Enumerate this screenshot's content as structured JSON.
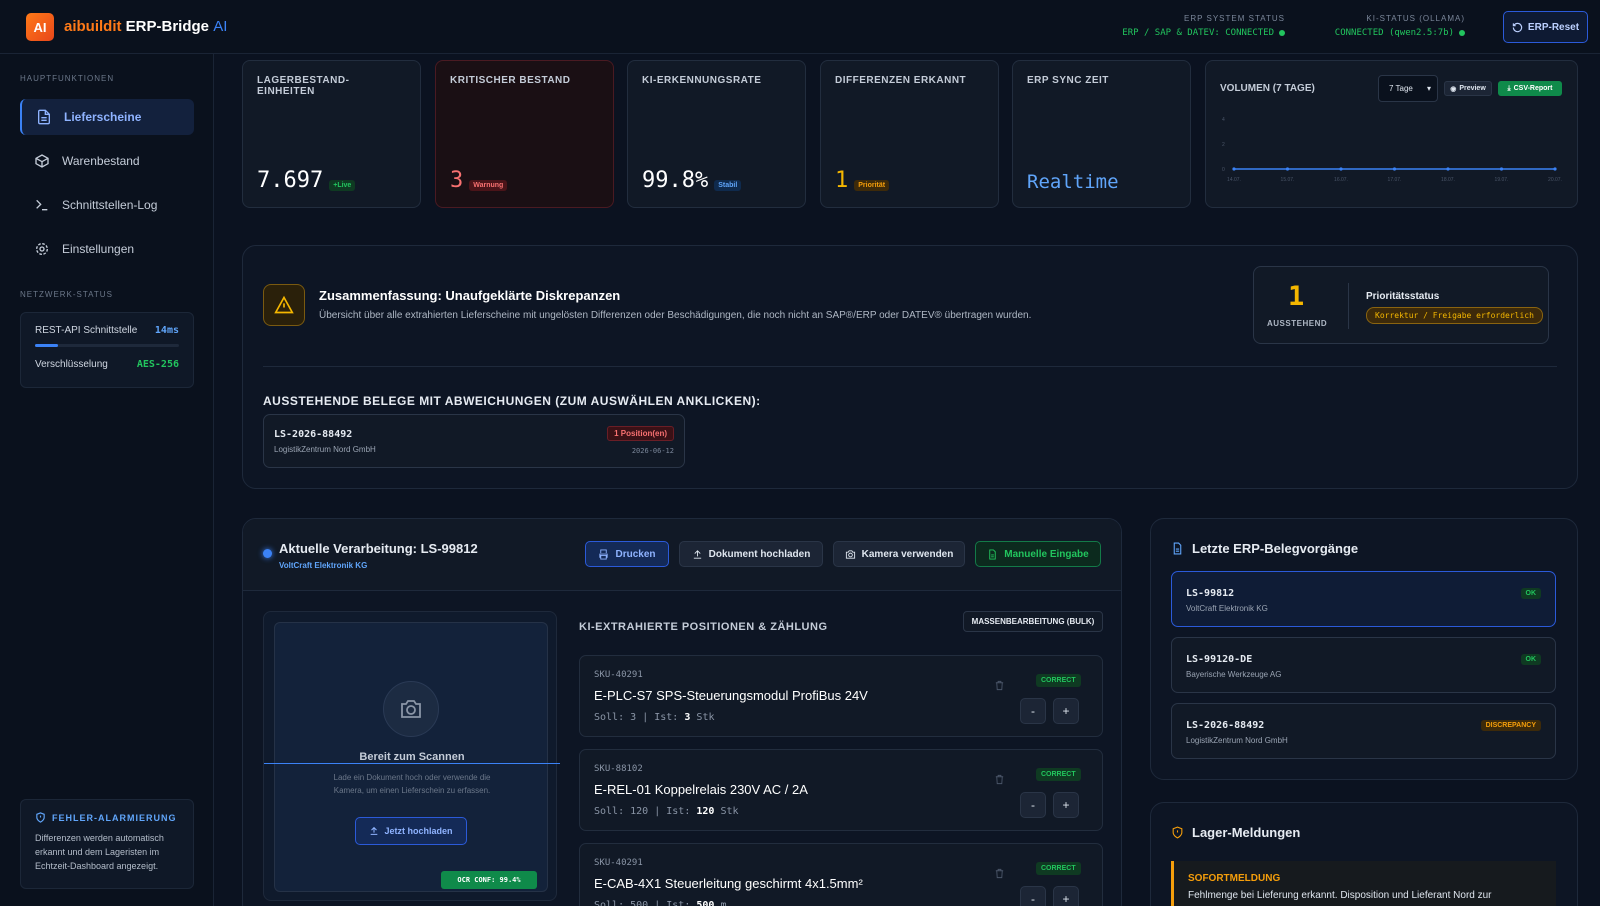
{
  "header": {
    "logo": "AI",
    "brand_1": "aibuildit",
    "brand_2": "ERP-Bridge",
    "brand_3": "AI",
    "erp_status_label": "ERP SYSTEM STATUS",
    "erp_status_value": "ERP / SAP & DATEV: CONNECTED",
    "ki_status_label": "KI-STATUS (OLLAMA)",
    "ki_status_value": "CONNECTED (qwen2.5:7b)",
    "reset_label": "ERP-Reset"
  },
  "sidebar": {
    "section_main": "HAUPTFUNKTIONEN",
    "items": [
      {
        "label": "Lieferscheine"
      },
      {
        "label": "Warenbestand"
      },
      {
        "label": "Schnittstellen-Log"
      },
      {
        "label": "Einstellungen"
      }
    ],
    "section_net": "NETZWERK-STATUS",
    "net": {
      "api_label": "REST-API Schnittstelle",
      "api_value": "14ms",
      "api_load": 0.16,
      "enc_label": "Verschlüsselung",
      "enc_value": "AES-256"
    },
    "alert": {
      "title": "FEHLER-ALARMIERUNG",
      "text": "Differenzen werden automatisch erkannt und dem Lageristen im Echtzeit-Dashboard angezeigt."
    }
  },
  "kpis": [
    {
      "label": "LAGERBESTAND-EINHEITEN",
      "value": "7.697",
      "tag": "+Live"
    },
    {
      "label": "KRITISCHER BESTAND",
      "value": "3",
      "tag": "Warnung"
    },
    {
      "label": "KI-ERKENNUNGSRATE",
      "value": "99.8%",
      "tag": "Stabil"
    },
    {
      "label": "DIFFERENZEN ERKANNT",
      "value": "1",
      "tag": "Priorität"
    },
    {
      "label": "ERP SYNC ZEIT",
      "value": "Realtime"
    }
  ],
  "volume": {
    "title": "VOLUMEN (7 TAGE)",
    "select": "7 Tage",
    "preview": "Preview",
    "csv": "CSV-Report"
  },
  "chart_data": {
    "type": "line",
    "x": [
      "14.07.",
      "15.07.",
      "16.07.",
      "17.07.",
      "18.07.",
      "19.07.",
      "20.07."
    ],
    "yticks": [
      "0",
      "2",
      "4"
    ],
    "ylim": [
      0,
      4
    ],
    "series": [
      {
        "values": [
          0,
          0,
          0,
          0,
          0,
          0,
          0
        ]
      }
    ],
    "color": "#3b82f6"
  },
  "discrepancy": {
    "title": "Zusammenfassung: Unaufgeklärte Diskrepanzen",
    "desc": "Übersicht über alle extrahierten Lieferscheine mit ungelösten Differenzen oder Beschädigungen, die noch nicht an SAP®/ERP oder DATEV® übertragen wurden.",
    "pending_count": "1",
    "pending_label": "AUSSTEHEND",
    "priority_label": "Prioritätsstatus",
    "priority_badge": "Korrektur / Freigabe erforderlich",
    "list_title": "AUSSTEHENDE BELEGE MIT ABWEICHUNGEN (ZUM AUSWÄHLEN ANKLICKEN):",
    "doc_id": "LS-2026-88492",
    "doc_company": "LogistikZentrum Nord GmbH",
    "doc_badge": "1 Position(en)",
    "doc_date": "2026-06-12"
  },
  "processing": {
    "title": "Aktuelle Verarbeitung: LS-99812",
    "company": "VoltCraft Elektronik KG",
    "btn_print": "Drucken",
    "btn_upload": "Dokument hochladen",
    "btn_camera": "Kamera verwenden",
    "btn_manual": "Manuelle Eingabe",
    "scan_ready": "Bereit zum Scannen",
    "scan_hint": "Lade ein Dokument hoch oder verwende die Kamera, um einen Lieferschein zu erfassen.",
    "scan_btn": "Jetzt hochladen",
    "ocr": "OCR CONF: 99.4%",
    "positions_title": "KI-EXTRAHIERTE POSITIONEN & ZÄHLUNG",
    "bulk": "MASSENBEARBEITUNG (BULK)",
    "items": [
      {
        "sku": "SKU-40291",
        "name": "E-PLC-S7 SPS-Steuerungsmodul ProfiBus 24V",
        "soll": "3",
        "ist": "3",
        "unit": "Stk",
        "status": "CORRECT"
      },
      {
        "sku": "SKU-88102",
        "name": "E-REL-01 Koppelrelais 230V AC / 2A",
        "soll": "120",
        "ist": "120",
        "unit": "Stk",
        "status": "CORRECT"
      },
      {
        "sku": "SKU-40291",
        "name": "E-CAB-4X1 Steuerleitung geschirmt 4x1.5mm²",
        "soll": "500",
        "ist": "500",
        "unit": "m",
        "status": "CORRECT"
      }
    ],
    "soll_label": "Soll:",
    "ist_label": "Ist:",
    "minus": "-",
    "plus": "+"
  },
  "recent": {
    "title": "Letzte ERP-Belegvorgänge",
    "items": [
      {
        "id": "LS-99812",
        "company": "VoltCraft Elektronik KG",
        "badge": "OK"
      },
      {
        "id": "LS-99120-DE",
        "company": "Bayerische Werkzeuge AG",
        "badge": "OK"
      },
      {
        "id": "LS-2026-88492",
        "company": "LogistikZentrum Nord GmbH",
        "badge": "DISCREPANCY"
      }
    ]
  },
  "lager": {
    "title": "Lager-Meldungen",
    "sofort_title": "SOFORTMELDUNG",
    "sofort_text": "Fehlmenge bei Lieferung erkannt. Disposition und Lieferant Nord zur"
  }
}
